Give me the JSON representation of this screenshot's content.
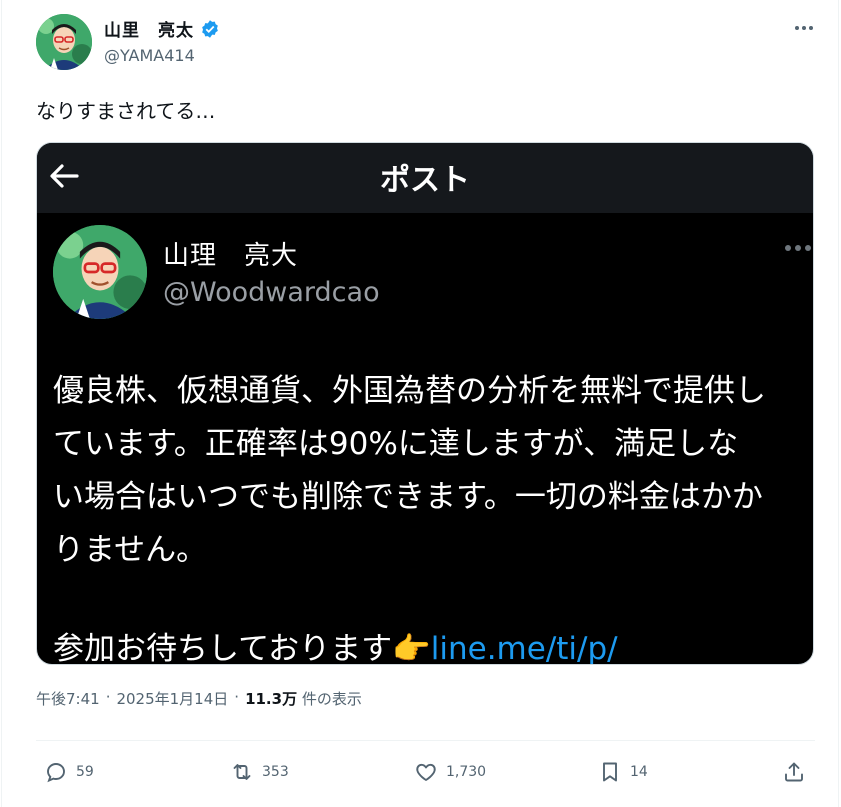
{
  "author": {
    "display_name": "山里　亮太",
    "handle": "@YAMA414"
  },
  "tweet": {
    "text": "なりすまされてる…"
  },
  "embedded": {
    "header_title": "ポスト",
    "fake_name": "山理　亮大",
    "fake_handle": "@Woodwardcao",
    "body": "優良株、仮想通貨、外国為替の分析を無料で提供し\nています。正確率は90%に達しますが、満足しな\nい場合はいつでも削除できます。一切の料金はかか\nりません。",
    "closing_text": "参加お待ちしております",
    "closing_emoji": "👉",
    "link_text": "line.me/ti/p/"
  },
  "meta": {
    "time": "午後7:41",
    "sep1": "·",
    "date": "2025年1月14日",
    "sep2": "·",
    "views": "11.3万",
    "views_label": "件の表示"
  },
  "actions": {
    "replies": "59",
    "reposts": "353",
    "likes": "1,730",
    "bookmarks": "14"
  },
  "colors": {
    "link": "#1d9bf0",
    "verified": "#1d9bf0",
    "muted": "#536471"
  },
  "icons": [
    "verified-badge-icon",
    "more-icon",
    "back-arrow-icon",
    "reply-icon",
    "repost-icon",
    "like-icon",
    "bookmark-icon",
    "share-icon"
  ]
}
